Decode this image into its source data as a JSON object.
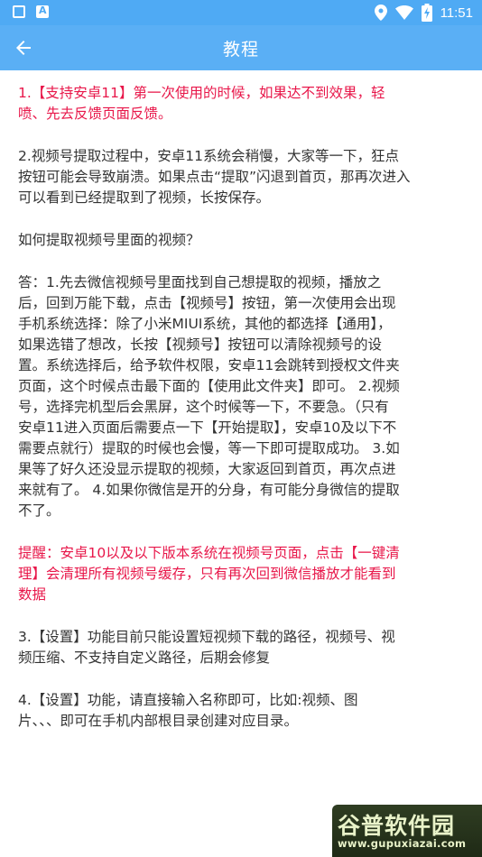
{
  "status_bar": {
    "time": "11:51",
    "badge_letter": "A",
    "icons": [
      "square-notification-icon",
      "a-notification-icon",
      "location-icon",
      "wifi-icon",
      "battery-charging-icon"
    ]
  },
  "app_bar": {
    "title": "教程",
    "back_icon": "arrow-left-icon"
  },
  "paragraphs": [
    {
      "text": "1.【支持安卓11】第一次使用的时候，如果达不到效果，轻\n喷、先去反馈页面反馈。",
      "color": "#e8174a"
    },
    {
      "text": "2.视频号提取过程中，安卓11系统会稍慢，大家等一下，狂点\n按钮可能会导致崩溃。如果点击“提取”闪退到首页，那再次进入\n可以看到已经提取到了视频，长按保存。",
      "color": "#333333"
    },
    {
      "text": "如何提取视频号里面的视频？",
      "color": "#333333"
    },
    {
      "text": "答：1.先去微信视频号里面找到自己想提取的视频，播放之\n后，回到万能下载，点击【视频号】按钮，第一次使用会出现\n手机系统选择：除了小米MIUI系统，其他的都选择【通用】，\n如果选错了想改，长按【视频号】按钮可以清除视频号的设\n置。系统选择后，给予软件权限，安卓11会跳转到授权文件夹\n页面，这个时候点击最下面的【使用此文件夹】即可。 2.视频\n号，选择完机型后会黑屏，这个时候等一下，不要急。（只有\n安卓11进入页面后需要点一下【开始提取】，安卓10及以下不\n需要点就行）提取的时候也会慢，等一下即可提取成功。 3.如\n果等了好久还没显示提取的视频，大家返回到首页，再次点进\n来就有了。 4.如果你微信是开的分身，有可能分身微信的提取\n不了。",
      "color": "#333333"
    },
    {
      "text": "提醒：安卓10以及以下版本系统在视频号页面，点击【一键清\n理】会清理所有视频号缓存，只有再次回到微信播放才能看到\n数据",
      "color": "#e8174a"
    },
    {
      "text": "3.【设置】功能目前只能设置短视频下载的路径，视频号、视\n频压缩、不支持自定义路径，后期会修复",
      "color": "#333333"
    },
    {
      "text": "4.【设置】功能，请直接输入名称即可，比如:视频、图\n片、、、即可在手机内部根目录创建对应目录。",
      "color": "#333333"
    }
  ],
  "watermark": {
    "title": "谷普软件园",
    "url": "www.gupuxiazai.com"
  },
  "colors": {
    "status_bar": "#4faaf4",
    "app_bar": "#5aaff5",
    "highlight_red": "#e8174a",
    "body_text": "#333333"
  }
}
